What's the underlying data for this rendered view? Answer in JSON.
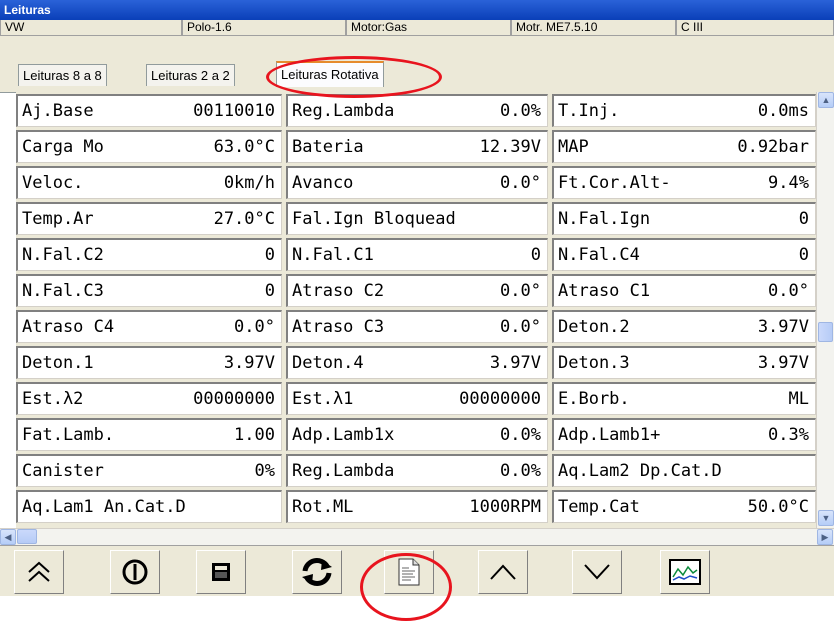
{
  "window": {
    "title": "Leituras"
  },
  "info_bar": [
    {
      "text": "VW"
    },
    {
      "text": "Polo-1.6"
    },
    {
      "text": "Motor:Gas"
    },
    {
      "text": "Motr. ME7.5.10"
    },
    {
      "text": "C III"
    }
  ],
  "tabs": [
    {
      "label": "Leituras 8 a 8",
      "active": false
    },
    {
      "label": "Leituras 2 a 2",
      "active": false
    },
    {
      "label": "Leituras Rotativa",
      "active": true
    }
  ],
  "readings": [
    [
      {
        "label": "Aj.Base",
        "value": "00110010"
      },
      {
        "label": "Reg.Lambda",
        "value": "0.0%"
      },
      {
        "label": "T.Inj.",
        "value": "0.0ms"
      }
    ],
    [
      {
        "label": "Carga Mo",
        "value": "63.0°C"
      },
      {
        "label": "Bateria",
        "value": "12.39V"
      },
      {
        "label": "MAP",
        "value": "0.92bar"
      }
    ],
    [
      {
        "label": "Veloc.",
        "value": "0km/h"
      },
      {
        "label": "Avanco",
        "value": "0.0°"
      },
      {
        "label": "Ft.Cor.Alt-",
        "value": "9.4%"
      }
    ],
    [
      {
        "label": "Temp.Ar",
        "value": "27.0°C"
      },
      {
        "label": "Fal.Ign Bloquead",
        "value": ""
      },
      {
        "label": "N.Fal.Ign",
        "value": "0"
      }
    ],
    [
      {
        "label": "N.Fal.C2",
        "value": "0"
      },
      {
        "label": "N.Fal.C1",
        "value": "0"
      },
      {
        "label": "N.Fal.C4",
        "value": "0"
      }
    ],
    [
      {
        "label": "N.Fal.C3",
        "value": "0"
      },
      {
        "label": "Atraso C2",
        "value": "0.0°"
      },
      {
        "label": "Atraso C1",
        "value": "0.0°"
      }
    ],
    [
      {
        "label": "Atraso C4",
        "value": "0.0°"
      },
      {
        "label": "Atraso C3",
        "value": "0.0°"
      },
      {
        "label": "Deton.2",
        "value": "3.97V"
      }
    ],
    [
      {
        "label": "Deton.1",
        "value": "3.97V"
      },
      {
        "label": "Deton.4",
        "value": "3.97V"
      },
      {
        "label": "Deton.3",
        "value": "3.97V"
      }
    ],
    [
      {
        "label": "Est.λ2",
        "value": "00000000"
      },
      {
        "label": "Est.λ1",
        "value": "00000000"
      },
      {
        "label": "E.Borb.",
        "value": "ML"
      }
    ],
    [
      {
        "label": "Fat.Lamb.",
        "value": "1.00"
      },
      {
        "label": "Adp.Lamb1x",
        "value": "0.0%"
      },
      {
        "label": "Adp.Lamb1+",
        "value": "0.3%"
      }
    ],
    [
      {
        "label": "Canister",
        "value": "0%"
      },
      {
        "label": "Reg.Lambda",
        "value": "0.0%"
      },
      {
        "label": "Aq.Lam2 Dp.Cat.D",
        "value": ""
      }
    ],
    [
      {
        "label": "Aq.Lam1 An.Cat.D",
        "value": ""
      },
      {
        "label": "Rot.ML",
        "value": "1000RPM"
      },
      {
        "label": "Temp.Cat",
        "value": "50.0°C"
      }
    ]
  ],
  "toolbar": [
    {
      "icon": "double-chevron-up-icon"
    },
    {
      "icon": "power-icon"
    },
    {
      "icon": "calculator-icon"
    },
    {
      "icon": "refresh-icon"
    },
    {
      "icon": "report-document-icon"
    },
    {
      "icon": "chevron-up-icon"
    },
    {
      "icon": "chevron-down-icon"
    },
    {
      "icon": "graph-icon"
    }
  ],
  "colors": {
    "title_bar": "#0a3fb8",
    "annotation": "#e8141e",
    "panel": "#ece9d8"
  }
}
